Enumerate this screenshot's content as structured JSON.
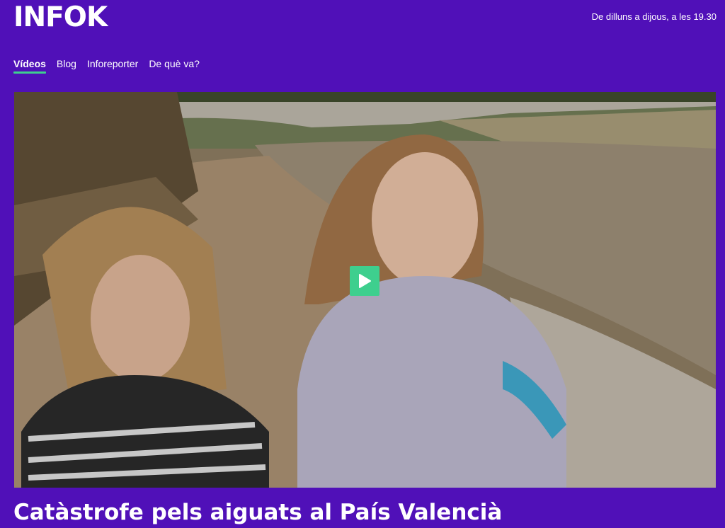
{
  "header": {
    "logo": "INFOK",
    "schedule": "De dilluns a dijous, a les 19.30"
  },
  "nav": {
    "items": [
      {
        "label": "Vídeos",
        "active": true
      },
      {
        "label": "Blog"
      },
      {
        "label": "Inforeporter"
      },
      {
        "label": "De què va?"
      }
    ]
  },
  "video": {
    "play_icon": "play-icon",
    "accent_color": "#3ecf8e"
  },
  "article": {
    "title": "Catàstrofe pels aiguats al País Valencià"
  },
  "colors": {
    "background": "#5010b8",
    "accent": "#3ecf8e"
  }
}
